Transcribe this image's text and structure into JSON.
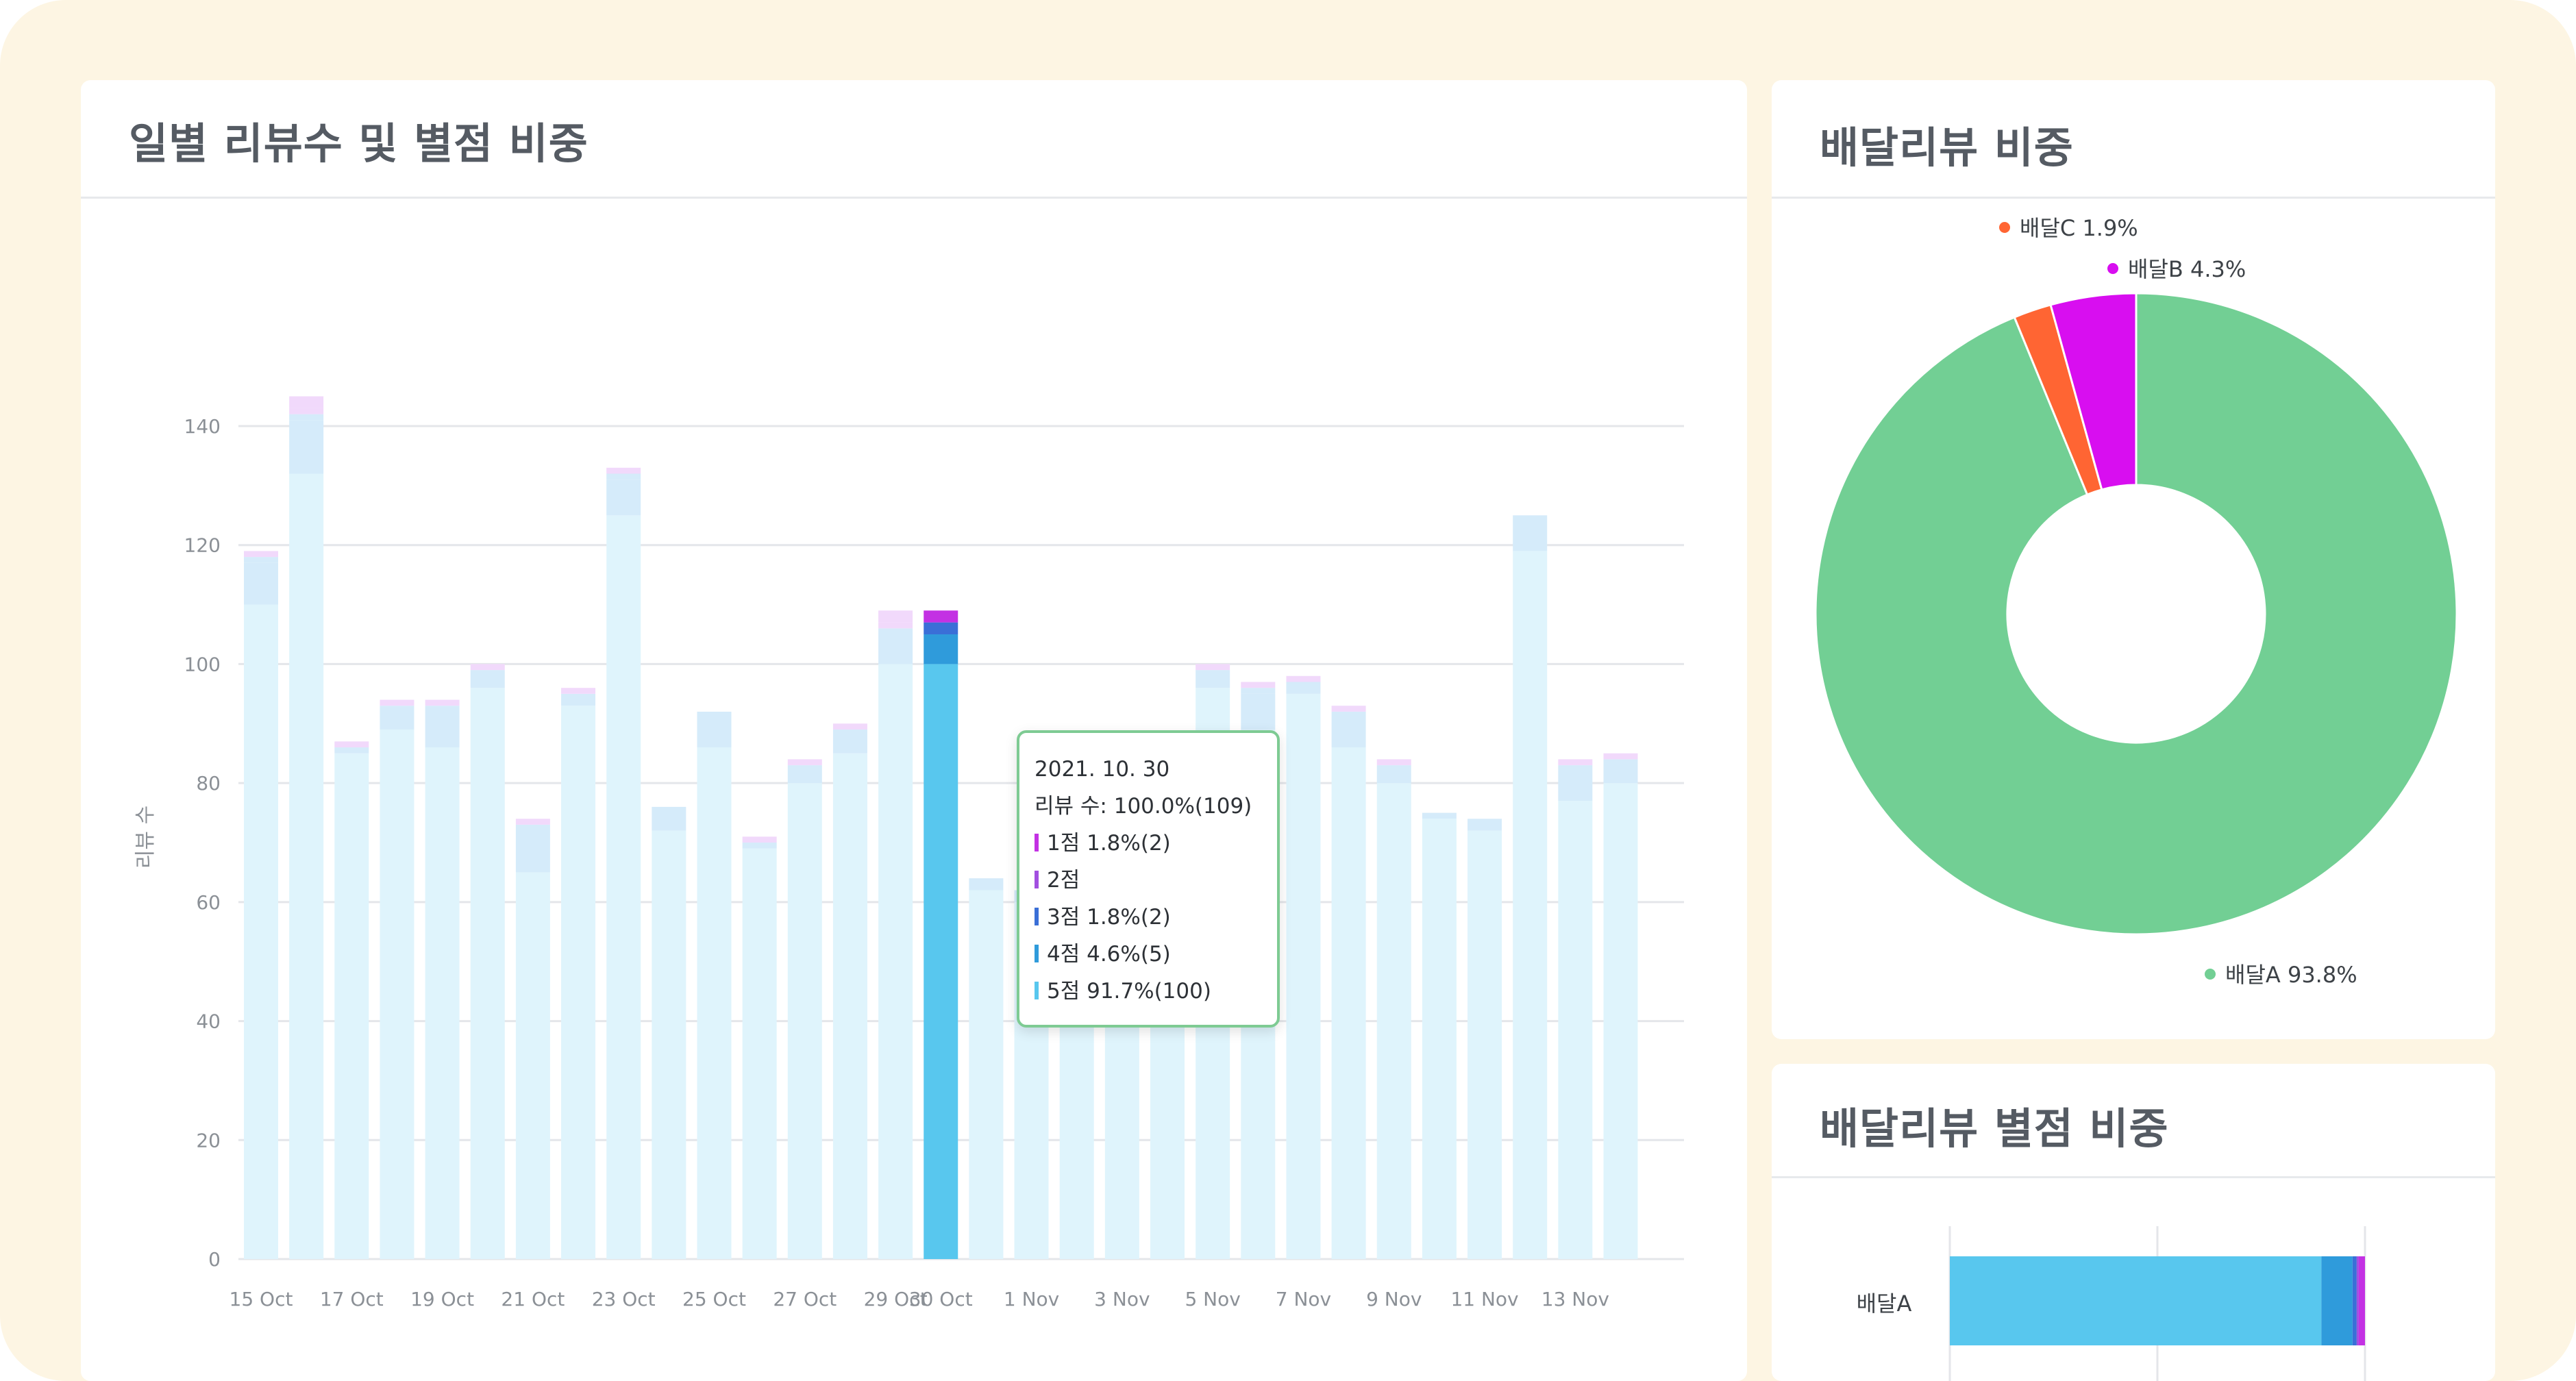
{
  "daily_card": {
    "title": "일별 리뷰수 및 별점 비중"
  },
  "delivery_share_card": {
    "title": "배달리뷰 비중"
  },
  "rating_share_card": {
    "title": "배달리뷰 별점 비중"
  },
  "colors": {
    "bar_light": "#dff4fc",
    "bar_light_mid": "#d5ebfa",
    "bar_light_pink": "#f1d9fb",
    "s5": "#58c7ee",
    "s4": "#2f9bdb",
    "s3": "#3a6fd7",
    "s2": "#a24fe0",
    "s1": "#c331e3",
    "pie_a": "#72cf94",
    "pie_b": "#d80ef0",
    "pie_c": "#ff6533",
    "tooltip_border": "#7ecb93"
  },
  "chart_data": [
    {
      "type": "bar",
      "stacked": true,
      "title": "일별 리뷰수 및 별점 비중",
      "ylabel": "리뷰 수",
      "ylim": [
        0,
        150
      ],
      "yticks": [
        0,
        20,
        40,
        60,
        80,
        100,
        120,
        140
      ],
      "grid": true,
      "categories": [
        "2021-10-15",
        "2021-10-16",
        "2021-10-17",
        "2021-10-18",
        "2021-10-19",
        "2021-10-20",
        "2021-10-21",
        "2021-10-22",
        "2021-10-23",
        "2021-10-24",
        "2021-10-25",
        "2021-10-26",
        "2021-10-27",
        "2021-10-28",
        "2021-10-29",
        "2021-10-30",
        "2021-10-31",
        "2021-11-01",
        "2021-11-02",
        "2021-11-03",
        "2021-11-04",
        "2021-11-05",
        "2021-11-06",
        "2021-11-07",
        "2021-11-08",
        "2021-11-09",
        "2021-11-10",
        "2021-11-11",
        "2021-11-12",
        "2021-11-13",
        "2021-11-14"
      ],
      "xtick_labels": [
        "15 Oct",
        "",
        "17 Oct",
        "",
        "19 Oct",
        "",
        "21 Oct",
        "",
        "23 Oct",
        "",
        "25 Oct",
        "",
        "27 Oct",
        "",
        "29 Oct",
        "30 Oct",
        "",
        "1 Nov",
        "",
        "3 Nov",
        "",
        "5 Nov",
        "",
        "7 Nov",
        "",
        "9 Nov",
        "",
        "11 Nov",
        "",
        "13 Nov",
        ""
      ],
      "series": [
        {
          "name": "5점",
          "values": [
            110,
            132,
            85,
            89,
            86,
            96,
            65,
            93,
            125,
            72,
            86,
            69,
            80,
            85,
            100,
            100,
            62,
            60,
            58,
            60,
            62,
            96,
            89,
            95,
            86,
            80,
            74,
            72,
            119,
            77,
            80
          ]
        },
        {
          "name": "4점",
          "values": [
            7,
            9,
            1,
            4,
            7,
            3,
            8,
            2,
            6,
            4,
            6,
            1,
            3,
            4,
            5,
            5,
            2,
            2,
            2,
            2,
            2,
            3,
            6,
            2,
            6,
            3,
            1,
            2,
            6,
            6,
            4
          ]
        },
        {
          "name": "3점",
          "values": [
            1,
            1,
            0,
            0,
            0,
            0,
            0,
            0,
            1,
            0,
            0,
            0,
            0,
            0,
            1,
            2,
            0,
            0,
            0,
            0,
            0,
            0,
            1,
            0,
            0,
            0,
            0,
            0,
            0,
            0,
            0
          ]
        },
        {
          "name": "2점",
          "values": [
            0,
            1,
            0,
            0,
            0,
            0,
            0,
            0,
            0,
            0,
            0,
            0,
            0,
            0,
            1,
            0,
            0,
            0,
            0,
            0,
            0,
            0,
            0,
            0,
            0,
            0,
            0,
            0,
            0,
            0,
            0
          ]
        },
        {
          "name": "1점",
          "values": [
            1,
            2,
            1,
            1,
            1,
            1,
            1,
            1,
            1,
            0,
            0,
            1,
            1,
            1,
            2,
            2,
            0,
            0,
            0,
            0,
            0,
            1,
            1,
            1,
            1,
            1,
            0,
            0,
            0,
            1,
            1
          ]
        }
      ],
      "highlighted_index": 15,
      "tooltip": {
        "date": "2021. 10. 30",
        "total_label": "리뷰 수:",
        "total_value": "100.0%(109)",
        "items": [
          {
            "name": "1점",
            "value": "1.8%(2)"
          },
          {
            "name": "2점",
            "value": ""
          },
          {
            "name": "3점",
            "value": "1.8%(2)"
          },
          {
            "name": "4점",
            "value": "4.6%(5)"
          },
          {
            "name": "5점",
            "value": "91.7%(100)"
          }
        ]
      }
    },
    {
      "type": "pie",
      "donut": true,
      "title": "배달리뷰 비중",
      "slices": [
        {
          "name": "배달A",
          "value": 93.8,
          "label": "93.8%"
        },
        {
          "name": "배달C",
          "value": 1.9,
          "label": "1.9%"
        },
        {
          "name": "배달B",
          "value": 4.3,
          "label": "4.3%"
        }
      ]
    },
    {
      "type": "bar",
      "orientation": "horizontal",
      "stacked": true,
      "title": "배달리뷰 별점 비중",
      "categories": [
        "배달A"
      ],
      "xlim": [
        0,
        100
      ],
      "series": [
        {
          "name": "5점",
          "values": [
            89.5
          ]
        },
        {
          "name": "4점",
          "values": [
            7.5
          ]
        },
        {
          "name": "3점",
          "values": [
            1.0
          ]
        },
        {
          "name": "2점",
          "values": [
            0.5
          ]
        },
        {
          "name": "1점",
          "values": [
            1.5
          ]
        }
      ]
    }
  ]
}
